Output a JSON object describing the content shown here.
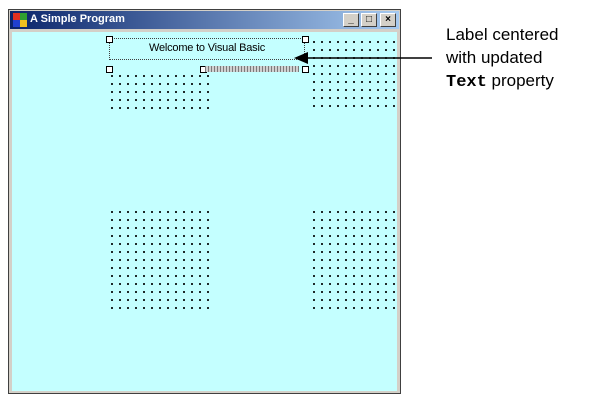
{
  "window": {
    "title": "A Simple Program",
    "controls": {
      "minimize": "_",
      "maximize": "□",
      "close": "×"
    }
  },
  "label": {
    "text": "Welcome to Visual Basic"
  },
  "callout": {
    "line1": "Label centered",
    "line2": "with updated",
    "line3_code": "Text",
    "line3_rest": " property"
  }
}
